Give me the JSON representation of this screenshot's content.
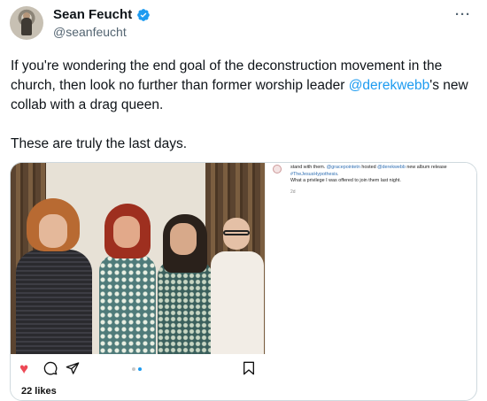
{
  "author": {
    "display_name": "Sean Feucht",
    "handle": "@seanfeucht",
    "verified": true,
    "verified_color": "#1d9bf0"
  },
  "more_label": "···",
  "tweet": {
    "text_before_mention": "If you're wondering the end goal of the deconstruction movement in the church, then look no further than former worship leader ",
    "mention": "@derekwebb",
    "text_after_mention": "'s new collab with a drag queen.",
    "second_paragraph": "These are truly the last days."
  },
  "embedded_post": {
    "caption_part1": "stand with them. ",
    "caption_mention1": "@gracepointetn",
    "caption_part2": " hosted ",
    "caption_mention2": "@derekwebb",
    "caption_part3": " new album release ",
    "caption_hashtag": "#TheJesusHypothesis",
    "caption_part4": ".",
    "caption_line2": "What a privilege I was offered to join them last night.",
    "time_ago": "2d",
    "likes": "22 likes",
    "icons": [
      "heart-icon",
      "comment-icon",
      "share-icon",
      "bookmark-icon"
    ],
    "like_color": "#ed4956"
  },
  "colors": {
    "link": "#1d9bf0",
    "text": "#0f1419",
    "muted": "#536471",
    "border": "#cfd9de"
  }
}
